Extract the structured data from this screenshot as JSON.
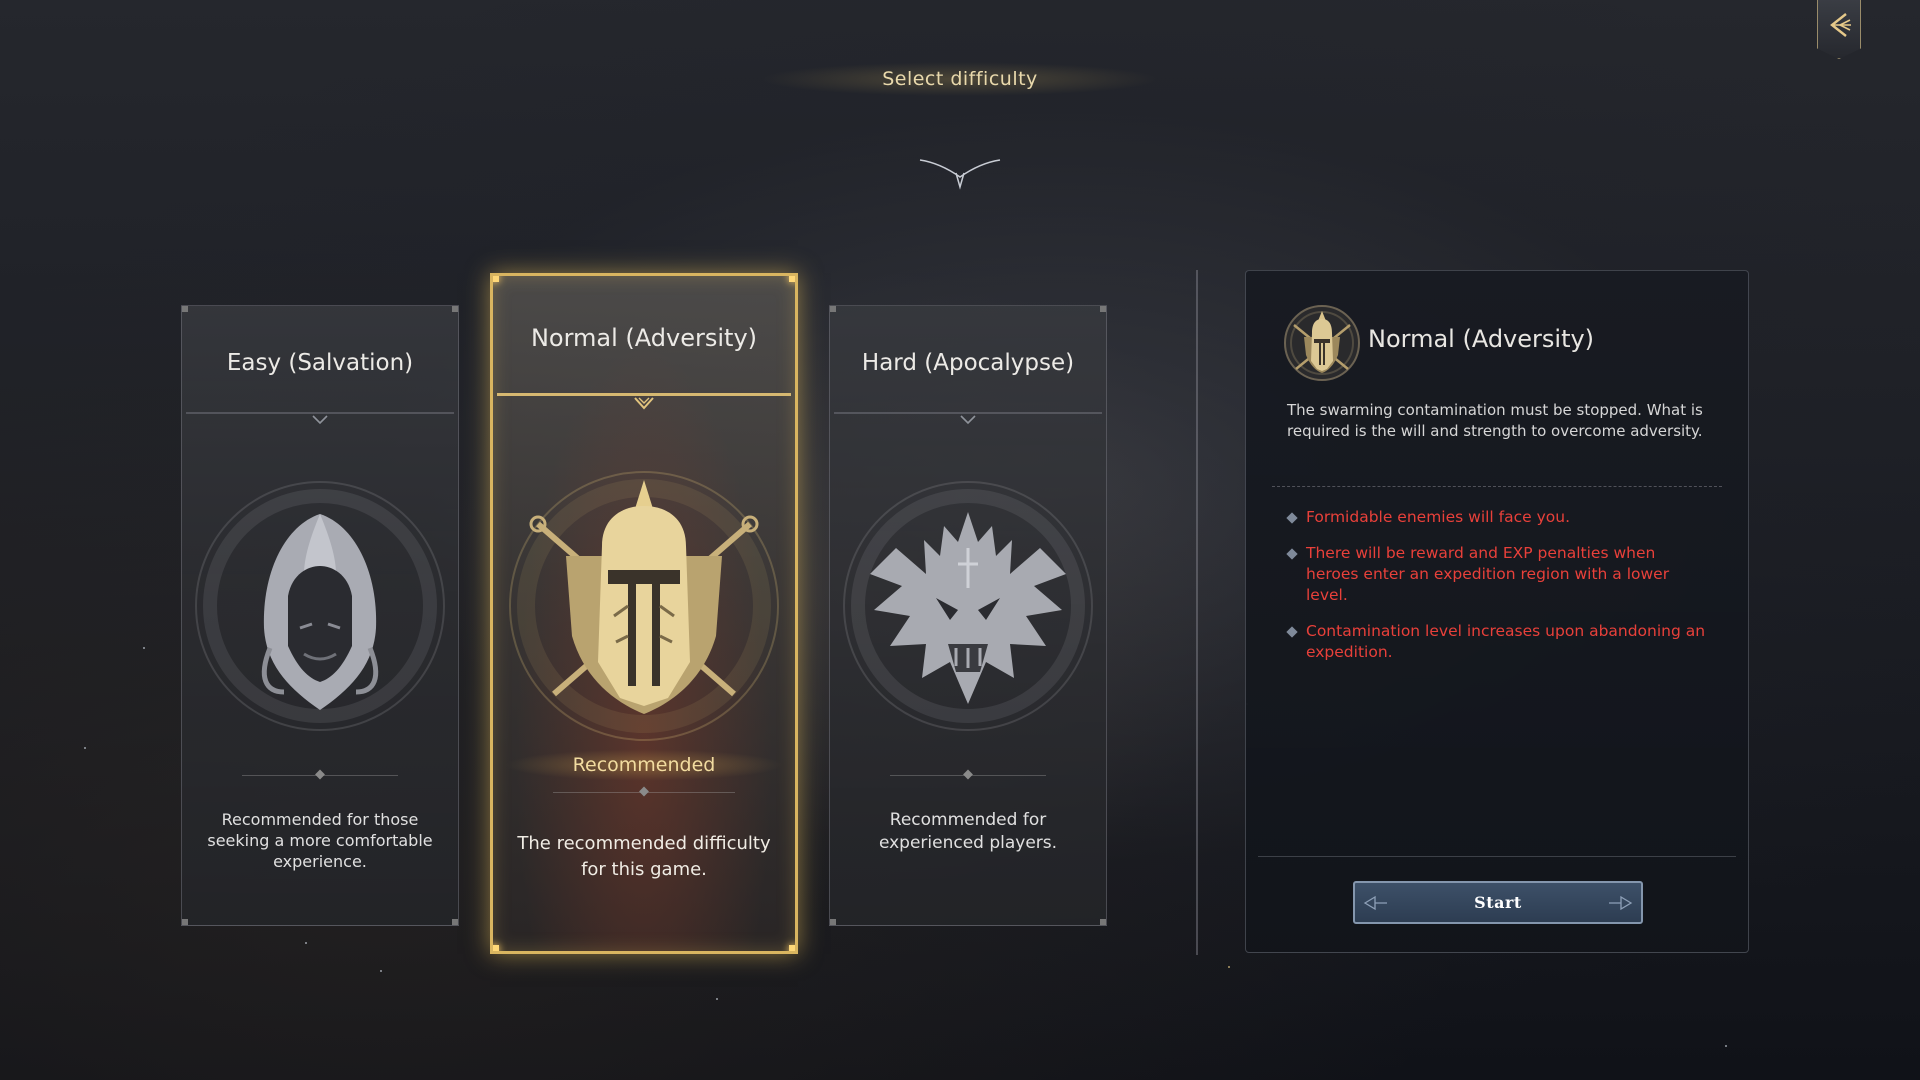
{
  "screen": {
    "title": "Select difficulty"
  },
  "back_button": {
    "icon": "back-arrow-icon"
  },
  "difficulties": [
    {
      "id": "easy",
      "title": "Easy (Salvation)",
      "description": "Recommended for those seeking a more comfortable experience.",
      "icon": "hooded-figure-icon",
      "selected": false
    },
    {
      "id": "normal",
      "title": "Normal (Adversity)",
      "badge": "Recommended",
      "description": "The recommended difficulty for this game.",
      "icon": "spartan-helmet-shield-icon",
      "selected": true
    },
    {
      "id": "hard",
      "title": "Hard (Apocalypse)",
      "description": "Recommended for experienced players.",
      "icon": "demon-skull-icon",
      "selected": false
    }
  ],
  "detail": {
    "title": "Normal (Adversity)",
    "icon": "spartan-helmet-icon",
    "description": "The swarming contamination must be stopped. What is required is the will and strength to overcome adversity.",
    "penalties": [
      "Formidable enemies will face you.",
      "There will be reward and EXP penalties when heroes enter an expedition region with a lower level.",
      "Contamination level increases upon abandoning an expedition."
    ],
    "start_label": "Start"
  },
  "colors": {
    "accent_gold": "#d9b560",
    "penalty_red": "#e8403a",
    "start_button": "#34465c"
  }
}
